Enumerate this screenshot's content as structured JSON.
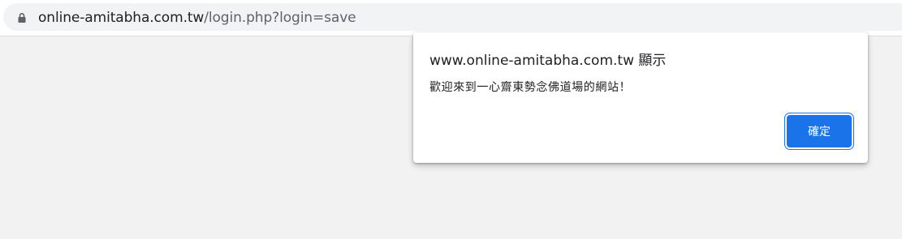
{
  "address_bar": {
    "host": "online-amitabha.com.tw",
    "path": "/login.php?login=save",
    "lock_icon": "lock-icon"
  },
  "dialog": {
    "title": "www.online-amitabha.com.tw 顯示",
    "message": "歡迎來到一心齋東勢念佛道場的網站！",
    "ok_label": "確定"
  },
  "colors": {
    "accent": "#1a73e8",
    "page_background": "#f2f2f2",
    "omnibox_background": "#f1f3f4"
  }
}
